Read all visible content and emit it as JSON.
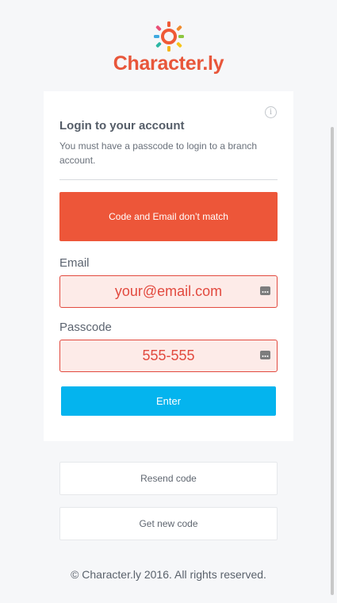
{
  "brand": {
    "name": "Character.ly",
    "brand_color": "#e8563a",
    "logo_icon": "rainbow-ring-logo-icon"
  },
  "card": {
    "info_icon": "info-icon",
    "info_glyph": "i",
    "title": "Login to your account",
    "subtitle": "You must have a passcode to login to a branch account.",
    "error_message": "Code and Email don’t match",
    "error_color": "#ed5639"
  },
  "form": {
    "email": {
      "label": "Email",
      "value": "your@email.com",
      "icon": "key-icon"
    },
    "passcode": {
      "label": "Passcode",
      "value": "555-555",
      "icon": "key-icon"
    },
    "submit_label": "Enter",
    "submit_color": "#04b4ee"
  },
  "secondary_actions": {
    "resend_label": "Resend code",
    "new_code_label": "Get new code"
  },
  "footer": {
    "copyright": "© Character.ly 2016. All rights reserved."
  }
}
